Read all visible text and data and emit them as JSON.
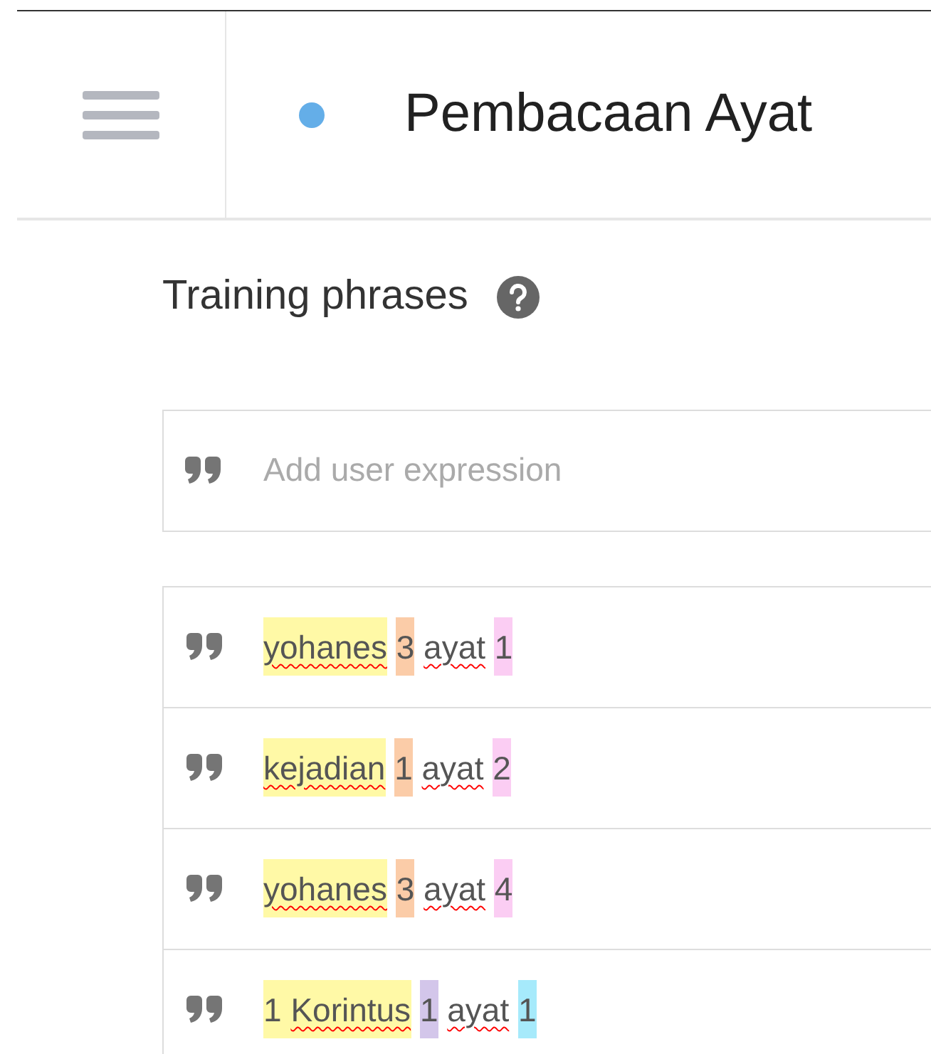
{
  "header": {
    "title": "Pembacaan Ayat"
  },
  "section": {
    "title": "Training phrases"
  },
  "input": {
    "placeholder": "Add user expression"
  },
  "phrases": [
    {
      "segments": [
        {
          "color": "#fff9a6",
          "words": [
            {
              "text": "yohanes",
              "misspelled": true
            }
          ]
        },
        {
          "color": "#fbcca8",
          "words": [
            {
              "text": "3",
              "misspelled": false
            }
          ]
        },
        {
          "words": [
            {
              "text": "ayat",
              "misspelled": true
            }
          ]
        },
        {
          "color": "#fbcdf3",
          "words": [
            {
              "text": "1",
              "misspelled": false
            }
          ]
        }
      ]
    },
    {
      "segments": [
        {
          "color": "#fff9a6",
          "words": [
            {
              "text": "kejadian",
              "misspelled": true
            }
          ]
        },
        {
          "color": "#fbcca8",
          "words": [
            {
              "text": "1",
              "misspelled": false
            }
          ]
        },
        {
          "words": [
            {
              "text": "ayat",
              "misspelled": true
            }
          ]
        },
        {
          "color": "#fbcdf3",
          "words": [
            {
              "text": "2",
              "misspelled": false
            }
          ]
        }
      ]
    },
    {
      "segments": [
        {
          "color": "#fff9a6",
          "words": [
            {
              "text": "yohanes",
              "misspelled": true
            }
          ]
        },
        {
          "color": "#fbcca8",
          "words": [
            {
              "text": "3",
              "misspelled": false
            }
          ]
        },
        {
          "words": [
            {
              "text": "ayat",
              "misspelled": true
            }
          ]
        },
        {
          "color": "#fbcdf3",
          "words": [
            {
              "text": "4",
              "misspelled": false
            }
          ]
        }
      ]
    },
    {
      "segments": [
        {
          "color": "#fff9a6",
          "words": [
            {
              "text": "1",
              "misspelled": false
            },
            {
              "text": "Korintus",
              "misspelled": true
            }
          ]
        },
        {
          "color": "#d3c6ea",
          "words": [
            {
              "text": "1",
              "misspelled": false
            }
          ]
        },
        {
          "words": [
            {
              "text": "ayat",
              "misspelled": true
            }
          ]
        },
        {
          "color": "#a6eafb",
          "words": [
            {
              "text": "1",
              "misspelled": false
            }
          ]
        }
      ]
    }
  ]
}
